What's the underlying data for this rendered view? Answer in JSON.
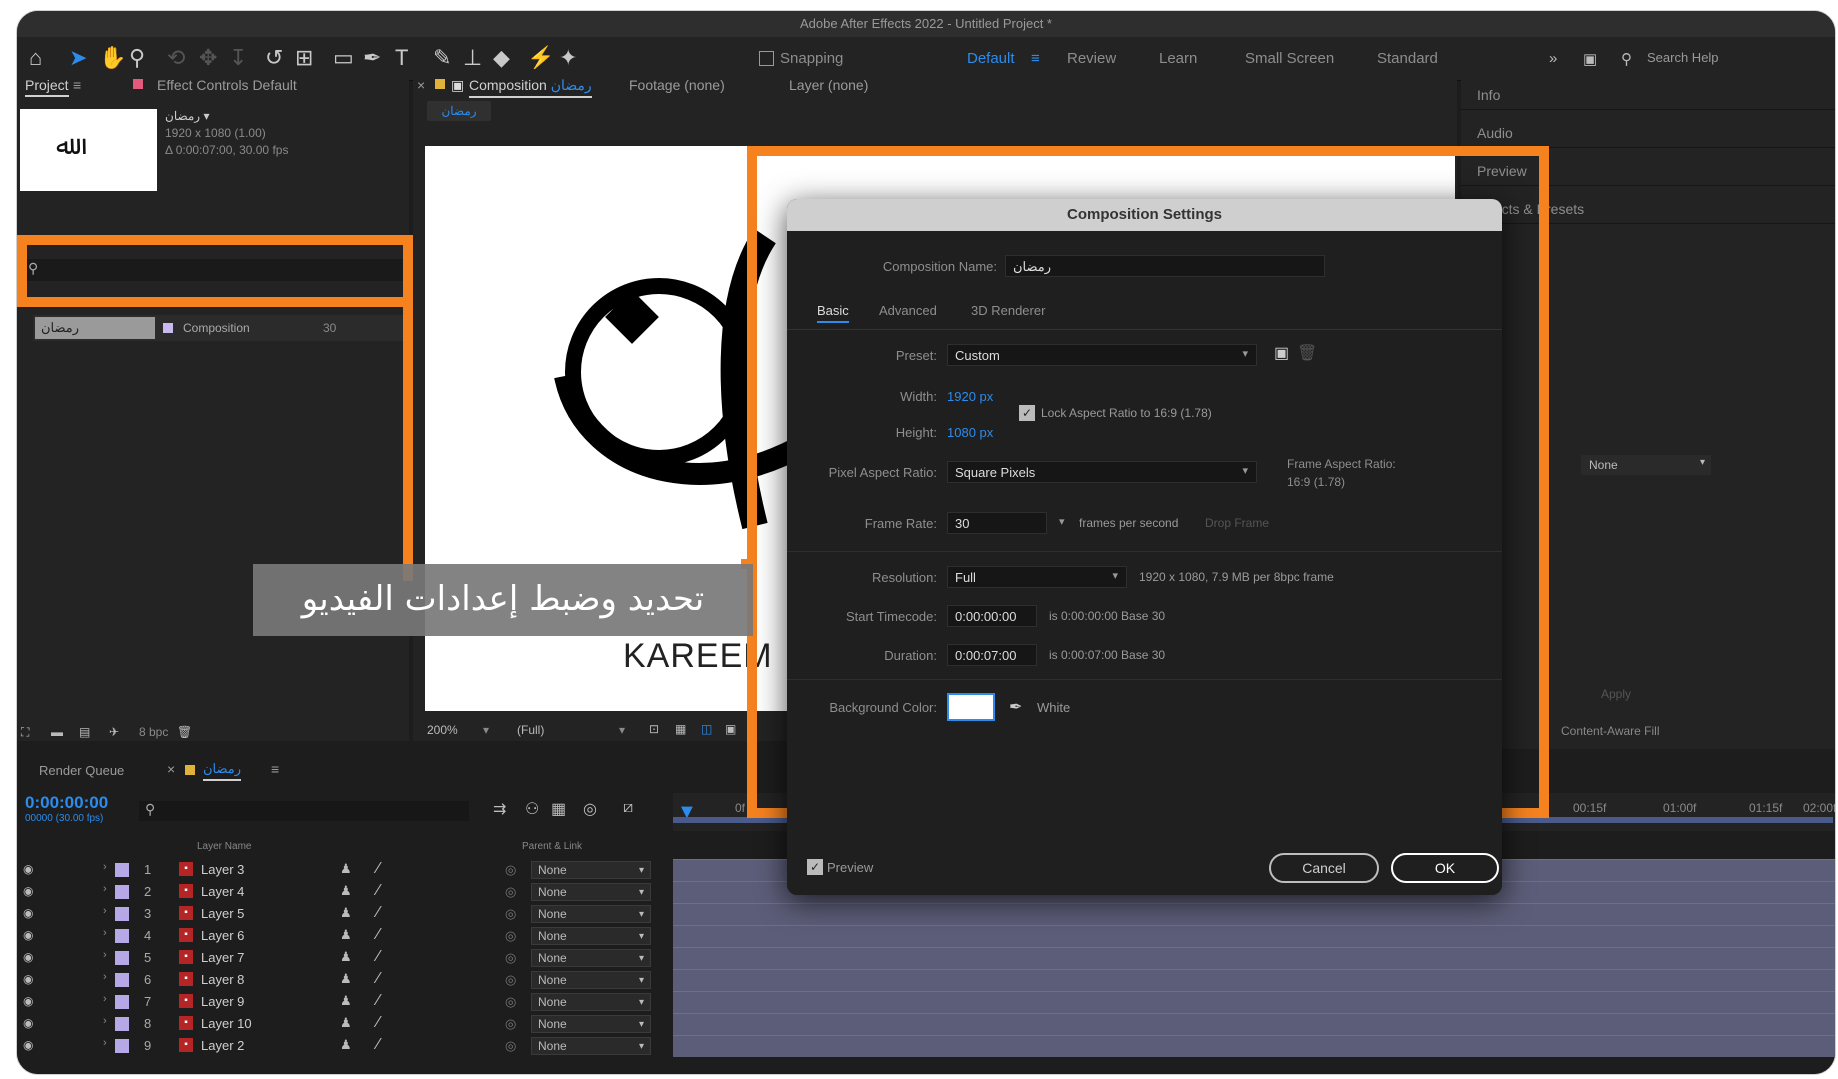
{
  "window": {
    "title": "Adobe After Effects 2022 - Untitled Project *"
  },
  "toolbar": {
    "snapping_label": "Snapping",
    "workspaces": [
      "Default",
      "Review",
      "Learn",
      "Small Screen",
      "Standard"
    ],
    "active_workspace": "Default",
    "search_help_placeholder": "Search Help"
  },
  "project_panel": {
    "tab_project": "Project",
    "tab_effect_controls": "Effect Controls Default",
    "comp_name": "رمضان ▾",
    "comp_size": "1920 x 1080 (1.00)",
    "comp_duration": "Δ 0:00:07:00, 30.00 fps",
    "item_name": "رمضان",
    "item_type": "Composition",
    "item_fps": "30",
    "bit_depth": "8 bpc"
  },
  "viewer": {
    "tab_composition": "Composition",
    "tab_composition_name": "رمضان",
    "tab_footage": "Footage (none)",
    "tab_layer": "Layer (none)",
    "breadcrumb": "رمضان",
    "artwork_text": "KAREEM",
    "zoom": "200%",
    "resolution": "(Full)"
  },
  "overlay_caption": "تحديد وضبط إعدادات الفيديو",
  "dialog": {
    "title": "Composition Settings",
    "comp_name_label": "Composition Name:",
    "comp_name_value": "رمضان",
    "tabs": [
      "Basic",
      "Advanced",
      "3D Renderer"
    ],
    "active_tab": "Basic",
    "preset_label": "Preset:",
    "preset_value": "Custom",
    "width_label": "Width:",
    "width_value": "1920 px",
    "height_label": "Height:",
    "height_value": "1080 px",
    "lock_aspect": "Lock Aspect Ratio to 16:9 (1.78)",
    "par_label": "Pixel Aspect Ratio:",
    "par_value": "Square Pixels",
    "far_label": "Frame Aspect Ratio:",
    "far_value": "16:9 (1.78)",
    "fps_label": "Frame Rate:",
    "fps_value": "30",
    "fps_unit": "frames per second",
    "drop_frame": "Drop Frame",
    "res_label": "Resolution:",
    "res_value": "Full",
    "res_info": "1920 x 1080, 7.9 MB per 8bpc frame",
    "start_label": "Start Timecode:",
    "start_value": "0:00:00:00",
    "start_info": "is 0:00:00:00 Base 30",
    "dur_label": "Duration:",
    "dur_value": "0:00:07:00",
    "dur_info": "is 0:00:07:00 Base 30",
    "bg_label": "Background Color:",
    "bg_value": "White",
    "preview_label": "Preview",
    "cancel": "Cancel",
    "ok": "OK",
    "bg_color": "#ffffff"
  },
  "right_panel": {
    "items": [
      "Info",
      "Audio",
      "Preview",
      "Effects & Presets"
    ],
    "track_matte_value": "None",
    "apply_label": "Apply",
    "fill_label": "Content-Aware Fill"
  },
  "timeline": {
    "tab_render_queue": "Render Queue",
    "tab_comp": "رمضان",
    "timecode": "0:00:00:00",
    "frame_info": "00000 (30.00 fps)",
    "col_layer_name": "Layer Name",
    "col_parent": "Parent & Link",
    "ruler": [
      "0f",
      "00:15f",
      "01:00f",
      "01:15f",
      "02:00f"
    ],
    "layers": [
      {
        "num": "1",
        "name": "Layer 3",
        "parent": "None"
      },
      {
        "num": "2",
        "name": "Layer 4",
        "parent": "None"
      },
      {
        "num": "3",
        "name": "Layer 5",
        "parent": "None"
      },
      {
        "num": "4",
        "name": "Layer 6",
        "parent": "None"
      },
      {
        "num": "5",
        "name": "Layer 7",
        "parent": "None"
      },
      {
        "num": "6",
        "name": "Layer 8",
        "parent": "None"
      },
      {
        "num": "7",
        "name": "Layer 9",
        "parent": "None"
      },
      {
        "num": "8",
        "name": "Layer 10",
        "parent": "None"
      },
      {
        "num": "9",
        "name": "Layer 2",
        "parent": "None"
      }
    ]
  },
  "colors": {
    "highlight": "#f5821f",
    "accent": "#2d8ceb",
    "layer_label": "#b6a7e6"
  }
}
